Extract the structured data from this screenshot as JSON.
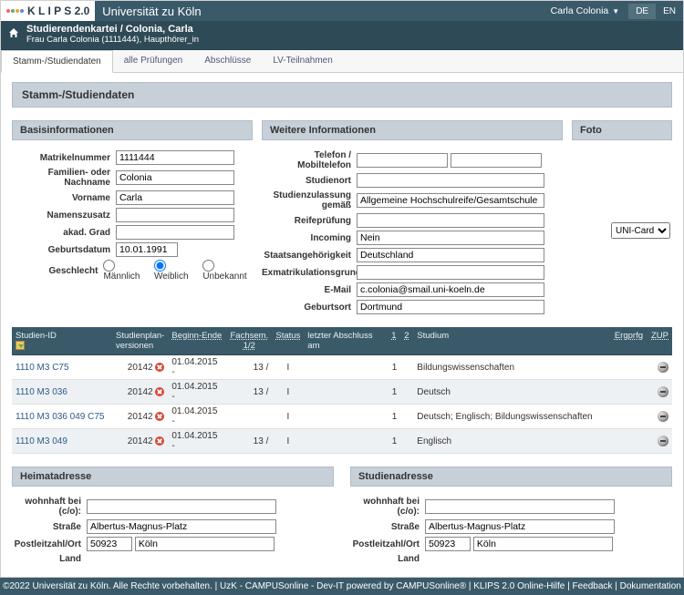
{
  "brand": {
    "logo_text": "K L I P S 2.0",
    "university": "Universität zu Köln"
  },
  "user": {
    "name": "Carla Colonia"
  },
  "lang": {
    "de": "DE",
    "en": "EN"
  },
  "header": {
    "title": "Studierendenkartei / Colonia, Carla",
    "sub": "Frau Carla Colonia (1111444), Haupthörer_in"
  },
  "tabs": {
    "stamm": "Stamm-/Studiendaten",
    "pruef": "alle Prüfungen",
    "absch": "Abschlüsse",
    "lv": "LV-Teilnahmen"
  },
  "page_bar": "Stamm-/Studiendaten",
  "sections": {
    "basis": "Basisinformationen",
    "weitere": "Weitere Informationen",
    "foto": "Foto",
    "heimat": "Heimatadresse",
    "studien": "Studienadresse"
  },
  "basis": {
    "labels": {
      "matrikel": "Matrikelnummer",
      "nachname": "Familien- oder Nachname",
      "vorname": "Vorname",
      "namenszusatz": "Namenszusatz",
      "akad": "akad. Grad",
      "geb": "Geburtsdatum",
      "geschlecht": "Geschlecht"
    },
    "values": {
      "matrikel": "1111444",
      "nachname": "Colonia",
      "vorname": "Carla",
      "namenszusatz": "",
      "akad": "",
      "geb": "10.01.1991"
    },
    "gender": {
      "m": "Männlich",
      "w": "Weiblich",
      "u": "Unbekannt",
      "selected": "w"
    }
  },
  "weitere": {
    "labels": {
      "tel": "Telefon / Mobiltelefon",
      "ort": "Studienort",
      "zulassung": "Studienzulassung gemäß",
      "reife": "Reifeprüfung",
      "incoming": "Incoming",
      "staat": "Staatsangehörigkeit",
      "exmat": "Exmatrikulationsgrund",
      "email": "E-Mail",
      "gebort": "Geburtsort"
    },
    "values": {
      "tel": "",
      "ort": "",
      "zulassung": "Allgemeine Hochschulreife/Gesamtschule",
      "reife": "",
      "incoming": "Nein",
      "staat": "Deutschland",
      "exmat": "",
      "email": "c.colonia@smail.uni-koeln.de",
      "gebort": "Dortmund"
    }
  },
  "foto": {
    "select": "UNI-Card"
  },
  "study_head": {
    "id": "Studien-ID",
    "plan": "Studienplan-\nversionen",
    "beginn": "Beginn-Ende",
    "fachsem": "Fachsem.\n1/2",
    "status": "Status",
    "letzter": "letzter Abschluss am",
    "c1": "1",
    "c2": "2",
    "studium": "Studium",
    "erg": "Ergprfg",
    "zup": "ZUP"
  },
  "study_rows": [
    {
      "id": "1110 M3 C75",
      "plan": "20142",
      "beginn": "01.04.2015 -",
      "fachsem": "13 /",
      "status": "I",
      "one": "1",
      "studium": "Bildungswissenschaften",
      "zup": true
    },
    {
      "id": "1110 M3 036",
      "plan": "20142",
      "beginn": "01.04.2015 -",
      "fachsem": "13 /",
      "status": "I",
      "one": "1",
      "studium": "Deutsch",
      "zup": true
    },
    {
      "id": "1110 M3 036 049 C75",
      "plan": "20142",
      "beginn": "01.04.2015 -",
      "fachsem": "",
      "status": "I",
      "one": "1",
      "studium": "Deutsch; Englisch; Bildungswissenschaften",
      "zup": true
    },
    {
      "id": "1110 M3 049",
      "plan": "20142",
      "beginn": "01.04.2015 -",
      "fachsem": "13 /",
      "status": "I",
      "one": "1",
      "studium": "Englisch",
      "zup": true
    }
  ],
  "addr": {
    "labels": {
      "co": "wohnhaft bei (c/o):",
      "str": "Straße",
      "plzort": "Postleitzahl/Ort",
      "land": "Land"
    },
    "home": {
      "co": "",
      "str": "Albertus-Magnus-Platz",
      "plz": "50923",
      "ort": "Köln",
      "land": ""
    },
    "study": {
      "co": "",
      "str": "Albertus-Magnus-Platz",
      "plz": "50923",
      "ort": "Köln",
      "land": ""
    }
  },
  "footer": {
    "copy": "©2022 Universität zu Köln. Alle Rechte vorbehalten.",
    "sep": " | ",
    "l1": "UzK - CAMPUSonline - Dev-IT powered by CAMPUSonline®",
    "l2": "KLIPS 2.0 Online-Hilfe",
    "l3": "Feedback",
    "l4": "Dokumentation"
  }
}
